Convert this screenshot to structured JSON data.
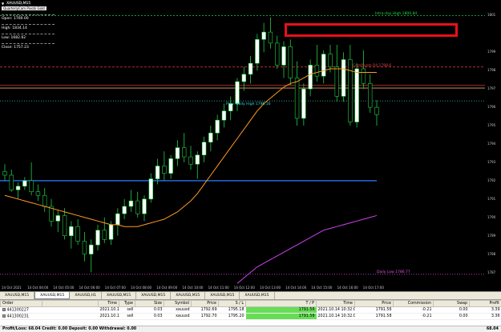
{
  "window": {
    "symbol_title": "XAUUSD,M15"
  },
  "info": {
    "pivot_label": "QuarterlyCam Pivots Gold",
    "open": "Open: 1769.00",
    "high": "High: 1834.14",
    "low": "Low: 1682.62",
    "close": "Close: 1757.23"
  },
  "chart_data": {
    "type": "candlestick",
    "symbol": "XAUUSD",
    "timeframe": "M15",
    "y_ticks": [
      "1801",
      "1799",
      "1798",
      "1797",
      "1796",
      "1795",
      "1794",
      "1793",
      "1792",
      "1791",
      "1790",
      "1789",
      "1788",
      "1787"
    ],
    "x_ticks": [
      "14 Oct 2021",
      "14 Oct 04:00",
      "14 Oct 05:00",
      "14 Oct 06:00",
      "14 Oct 07:00",
      "14 Oct 08:00",
      "14 Oct 09:00",
      "14 Oct 10:00",
      "14 Oct 11:00",
      "14 Oct 12:00",
      "14 Oct 13:00",
      "14 Oct 14:00",
      "14 Oct 15:00",
      "14 Oct 16:00",
      "14 Oct 17:00"
    ],
    "ylim": [
      1786.5,
      1801.5
    ],
    "candles": [
      [
        1792.5,
        1792.9,
        1792.0,
        1792.3
      ],
      [
        1792.3,
        1792.6,
        1791.4,
        1791.5
      ],
      [
        1791.5,
        1791.9,
        1791.0,
        1791.7
      ],
      [
        1791.7,
        1792.2,
        1791.5,
        1792.0
      ],
      [
        1792.0,
        1793.0,
        1791.2,
        1791.4
      ],
      [
        1791.4,
        1791.8,
        1790.9,
        1791.2
      ],
      [
        1791.2,
        1791.6,
        1790.3,
        1790.6
      ],
      [
        1790.6,
        1791.0,
        1789.5,
        1789.8
      ],
      [
        1789.8,
        1790.4,
        1789.2,
        1790.1
      ],
      [
        1790.1,
        1790.5,
        1788.8,
        1789.0
      ],
      [
        1789.0,
        1789.8,
        1788.3,
        1789.5
      ],
      [
        1789.5,
        1789.9,
        1788.5,
        1788.7
      ],
      [
        1788.7,
        1789.2,
        1787.6,
        1788.0
      ],
      [
        1788.0,
        1788.8,
        1787.0,
        1788.5
      ],
      [
        1788.5,
        1789.6,
        1788.2,
        1789.3
      ],
      [
        1789.3,
        1790.0,
        1788.6,
        1788.8
      ],
      [
        1788.8,
        1789.8,
        1788.5,
        1789.6
      ],
      [
        1789.6,
        1790.5,
        1789.0,
        1790.2
      ],
      [
        1790.2,
        1791.0,
        1789.9,
        1790.6
      ],
      [
        1790.6,
        1791.5,
        1790.3,
        1790.9
      ],
      [
        1790.9,
        1791.4,
        1790.0,
        1790.2
      ],
      [
        1790.2,
        1791.2,
        1789.8,
        1791.0
      ],
      [
        1791.0,
        1792.4,
        1790.8,
        1792.1
      ],
      [
        1792.1,
        1793.2,
        1791.8,
        1792.8
      ],
      [
        1792.8,
        1793.6,
        1792.0,
        1792.4
      ],
      [
        1792.4,
        1793.4,
        1792.1,
        1793.2
      ],
      [
        1793.2,
        1794.2,
        1792.8,
        1793.8
      ],
      [
        1793.8,
        1794.6,
        1793.0,
        1793.3
      ],
      [
        1793.3,
        1793.9,
        1792.6,
        1792.9
      ],
      [
        1792.9,
        1793.6,
        1792.1,
        1793.4
      ],
      [
        1793.4,
        1794.4,
        1793.0,
        1794.1
      ],
      [
        1794.1,
        1795.0,
        1793.6,
        1794.6
      ],
      [
        1794.6,
        1795.6,
        1794.2,
        1795.3
      ],
      [
        1795.3,
        1796.2,
        1794.9,
        1795.8
      ],
      [
        1795.8,
        1796.6,
        1795.3,
        1796.2
      ],
      [
        1796.2,
        1797.6,
        1795.8,
        1797.4
      ],
      [
        1797.4,
        1798.2,
        1796.9,
        1797.8
      ],
      [
        1797.8,
        1798.8,
        1797.3,
        1798.4
      ],
      [
        1798.4,
        1800.0,
        1798.0,
        1799.7
      ],
      [
        1799.7,
        1800.6,
        1799.0,
        1800.1
      ],
      [
        1800.1,
        1800.9,
        1799.2,
        1799.5
      ],
      [
        1799.5,
        1799.9,
        1798.1,
        1798.3
      ],
      [
        1798.3,
        1799.6,
        1797.6,
        1799.3
      ],
      [
        1799.3,
        1799.7,
        1797.2,
        1797.6
      ],
      [
        1797.6,
        1798.5,
        1795.0,
        1795.4
      ],
      [
        1795.4,
        1797.3,
        1795.0,
        1797.0
      ],
      [
        1797.0,
        1798.6,
        1796.6,
        1798.3
      ],
      [
        1798.3,
        1799.4,
        1797.4,
        1797.7
      ],
      [
        1797.7,
        1799.1,
        1797.3,
        1798.9
      ],
      [
        1798.9,
        1799.4,
        1797.9,
        1798.2
      ],
      [
        1798.2,
        1799.4,
        1796.3,
        1796.6
      ],
      [
        1796.6,
        1799.0,
        1796.3,
        1798.6
      ],
      [
        1798.6,
        1799.4,
        1795.0,
        1795.2
      ],
      [
        1795.2,
        1798.4,
        1794.9,
        1798.1
      ],
      [
        1798.1,
        1799.1,
        1797.0,
        1797.3
      ],
      [
        1797.3,
        1797.8,
        1795.7,
        1796.0
      ],
      [
        1796.0,
        1796.4,
        1795.0,
        1795.6
      ]
    ],
    "ma_orange": [
      1791.2,
      1791.1,
      1791.0,
      1790.9,
      1790.8,
      1790.7,
      1790.6,
      1790.5,
      1790.4,
      1790.3,
      1790.2,
      1790.1,
      1790.0,
      1789.9,
      1789.8,
      1789.7,
      1789.6,
      1789.6,
      1789.5,
      1789.5,
      1789.5,
      1789.6,
      1789.7,
      1789.8,
      1789.9,
      1790.1,
      1790.3,
      1790.6,
      1790.9,
      1791.3,
      1791.8,
      1792.3,
      1792.8,
      1793.3,
      1793.8,
      1794.3,
      1794.8,
      1795.3,
      1795.8,
      1796.2,
      1796.5,
      1796.8,
      1797.1,
      1797.3,
      1797.4,
      1797.6,
      1797.8,
      1797.9,
      1798.0,
      1798.1,
      1798.1,
      1798.1,
      1798.0,
      1797.9,
      1797.9,
      1797.9,
      1797.9
    ],
    "ma_magenta": [
      null,
      null,
      null,
      null,
      null,
      null,
      null,
      null,
      null,
      null,
      null,
      null,
      null,
      null,
      null,
      null,
      null,
      null,
      null,
      null,
      null,
      null,
      null,
      null,
      null,
      null,
      null,
      null,
      null,
      null,
      null,
      null,
      null,
      null,
      null,
      1786.4,
      1786.7,
      1787.0,
      1787.3,
      1787.5,
      1787.7,
      1787.9,
      1788.1,
      1788.3,
      1788.5,
      1788.7,
      1788.9,
      1789.1,
      1789.3,
      1789.4,
      1789.5,
      1789.6,
      1789.7,
      1789.8,
      1789.9,
      1790.0,
      1790.1
    ],
    "hlines": [
      {
        "price": 1801.0,
        "color": "#22cc44",
        "dash": "2,2",
        "label": "Intra-day High 1800.84",
        "label_color": "#22dd44"
      },
      {
        "price": 1798.2,
        "color": "#cc3333",
        "dash": "3,2",
        "label": "CamPivots R4 1798.6",
        "label_color": "#dd4444"
      },
      {
        "price": 1797.2,
        "color": "#cc3333",
        "dash": "",
        "label": "",
        "label_color": ""
      },
      {
        "price": 1797.05,
        "color": "#e8a060",
        "dash": "",
        "label": "",
        "label_color": ""
      },
      {
        "price": 1796.35,
        "color": "#33cccc",
        "dash": "1,2",
        "label": "Prev. Daily High 1796.16",
        "label_color": "#33dddd"
      },
      {
        "price": 1792.0,
        "color": "#2266dd",
        "dash": "",
        "label": "",
        "label_color": ""
      },
      {
        "price": 1786.9,
        "color": "#cc44cc",
        "dash": "1,2",
        "label": "Daily Low 1786.77",
        "label_color": "#dd55dd"
      }
    ]
  },
  "tabs": [
    "XAUUSD,M15",
    "XAUUSD,M15",
    "XAUUSD,H1",
    "XAUUSD,M15",
    "XAUUSD,M15",
    "XAUUSD,M15",
    "XAUUSD,M15",
    "XAUUSD,M15"
  ],
  "orders": {
    "headers": [
      "Order",
      "Time",
      "Type",
      "Size",
      "Symbol",
      "Price",
      "S / L",
      "T / P",
      "Time",
      "Price",
      "Commission",
      "Swap",
      "Profit"
    ],
    "rows": [
      [
        "441300227",
        "2021.10.14 10:14:43",
        "sell",
        "0.03",
        "xauusd",
        "1792.69",
        "1795.18",
        "1791.56",
        "2021.10.14 10:32:01",
        "1791.56",
        "-0.21",
        "0.00",
        "3.39"
      ],
      [
        "441300231",
        "2021.10.14 10:14:43",
        "sell",
        "0.03",
        "xauusd",
        "1792.70",
        "1795.20",
        "1791.58",
        "2021.10.14 10:32:01",
        "1791.58",
        "-0.21",
        "0.00",
        "3.36"
      ]
    ],
    "summary": "Profit/Loss: 68.04  Credit: 0.00  Deposit: 0.00  Withdrawal: 0.00",
    "total": "68.04"
  },
  "colors": {
    "bull": "#ffffff",
    "bear": "#000000",
    "wick": "#22cc44",
    "orange_ma": "#ff9922",
    "magenta_ma": "#cc44ee"
  }
}
